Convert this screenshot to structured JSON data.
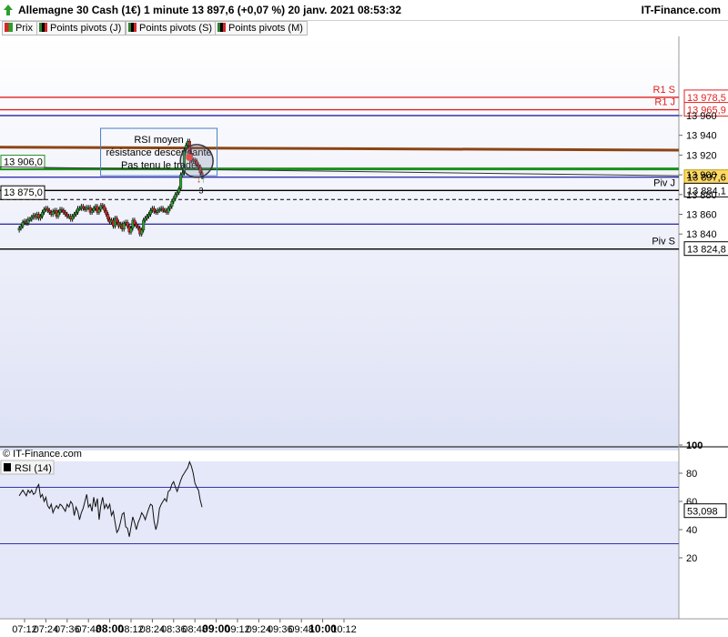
{
  "header": {
    "title": "Allemagne 30 Cash (1€) 1 minute 13 897,6 (+0,07 %) 20 janv. 2021 08:53:32",
    "brand": "IT-Finance.com"
  },
  "legend": [
    {
      "label": "Prix",
      "color": "#d9534f"
    },
    {
      "label": "Points pivots (J)",
      "color": "#2e7d32"
    },
    {
      "label": "Points pivots (S)",
      "color": "#2e7d32"
    },
    {
      "label": "Points pivots (M)",
      "color": "#2e7d32"
    }
  ],
  "colors": {
    "up": "#2ca02c",
    "down": "#d62728",
    "blue_line": "#3333aa",
    "red_line": "#e02020",
    "brown_line": "#8b4513",
    "green_line": "#1a8f1a",
    "label_bg": "#ffd966",
    "price_panel_bg": "#eef0fb"
  },
  "copyright": "© IT-Finance.com",
  "chart_data": [
    {
      "type": "candlestick",
      "y_ticks": [
        13840,
        13860,
        13880,
        13900,
        13920,
        13940,
        13960
      ],
      "y_tick_labels": [
        "13 840",
        "13 860",
        "13 880",
        "13 900",
        "13 920",
        "13 940",
        "13 960"
      ],
      "ylim": [
        13824,
        13990
      ],
      "x_tick_labels": [
        "07:12",
        "07:24",
        "07:36",
        "07:48",
        "08:00",
        "08:12",
        "08:24",
        "08:36",
        "08:48",
        "09:00",
        "09:12",
        "09:24",
        "09:36",
        "09:48",
        "10:00",
        "10:12"
      ],
      "bold_x_ticks": [
        "08:00",
        "09:00",
        "10:00"
      ],
      "x_start": "07:09",
      "minutes_per_bar": 1,
      "levels": [
        {
          "name": "R1 S",
          "value": 13978.5,
          "label": "13 978,5",
          "color": "#e02020"
        },
        {
          "name": "R1 J",
          "value": 13965.9,
          "label": "13 965,9",
          "color": "#e02020"
        },
        {
          "name": "",
          "value": 13960,
          "label": "",
          "color": "#3333aa"
        },
        {
          "name": "",
          "value": 13897.6,
          "label": "13 897,6",
          "color": "#3333aa",
          "highlight": true
        },
        {
          "name": "Piv J",
          "value": 13884.1,
          "label": "13 884,1",
          "color": "#000000"
        },
        {
          "name": "",
          "value": 13850,
          "label": "",
          "color": "#3333aa"
        },
        {
          "name": "Piv S",
          "value": 13824.8,
          "label": "13 824,8",
          "color": "#000000"
        }
      ],
      "green_line": {
        "value": 13906.0,
        "label": "13 906,0"
      },
      "dashed_line": {
        "value": 13875.0,
        "label": "13 875,0"
      },
      "brown_trend": {
        "start": 13928,
        "end": 13925
      },
      "gray_trend": {
        "start": 13908,
        "end": 13899
      },
      "annotation": [
        "RSI moyen",
        "résistance descendante",
        "Pas tenu le trade"
      ],
      "trade_marker": "3",
      "close": [
        13846,
        13848,
        13852,
        13853,
        13851,
        13855,
        13855,
        13857,
        13859,
        13857,
        13860,
        13856,
        13858,
        13862,
        13865,
        13866,
        13864,
        13862,
        13860,
        13863,
        13864,
        13858,
        13862,
        13865,
        13864,
        13862,
        13860,
        13858,
        13858,
        13855,
        13858,
        13860,
        13862,
        13866,
        13866,
        13868,
        13866,
        13865,
        13867,
        13867,
        13862,
        13864,
        13866,
        13868,
        13862,
        13865,
        13869,
        13868,
        13864,
        13860,
        13855,
        13852,
        13854,
        13848,
        13856,
        13852,
        13848,
        13850,
        13845,
        13851,
        13852,
        13848,
        13842,
        13846,
        13854,
        13850,
        13848,
        13846,
        13840,
        13844,
        13854,
        13856,
        13858,
        13860,
        13864,
        13866,
        13863,
        13862,
        13864,
        13865,
        13866,
        13864,
        13864,
        13862,
        13866,
        13868,
        13873,
        13876,
        13880,
        13882,
        13886,
        13900,
        13902,
        13925,
        13930,
        13934,
        13922,
        13914,
        13915,
        13914,
        13910,
        13908,
        13902,
        13898
      ]
    },
    {
      "type": "line",
      "title": "RSI (14)",
      "y_ticks": [
        20,
        40,
        60,
        80,
        100
      ],
      "ylim": [
        0,
        110
      ],
      "bands": [
        30,
        70
      ],
      "last_value": 53.098,
      "last_label": "53,098",
      "values": [
        64,
        66,
        68,
        66,
        64,
        68,
        66,
        68,
        65,
        66,
        70,
        72,
        63,
        65,
        60,
        63,
        57,
        55,
        58,
        52,
        55,
        57,
        55,
        58,
        57,
        55,
        53,
        58,
        56,
        60,
        58,
        50,
        56,
        53,
        47,
        52,
        55,
        60,
        65,
        56,
        58,
        53,
        63,
        56,
        62,
        47,
        57,
        63,
        55,
        58,
        55,
        58,
        50,
        53,
        45,
        38,
        40,
        45,
        51,
        52,
        42,
        41,
        35,
        42,
        49,
        45,
        40,
        45,
        48,
        52,
        50,
        47,
        51,
        55,
        58,
        57,
        46,
        40,
        45,
        55,
        58,
        60,
        62,
        60,
        67,
        68,
        72,
        74,
        70,
        67,
        71,
        75,
        78,
        80,
        82,
        84,
        88,
        85,
        80,
        73,
        70,
        68,
        61,
        56
      ]
    }
  ]
}
